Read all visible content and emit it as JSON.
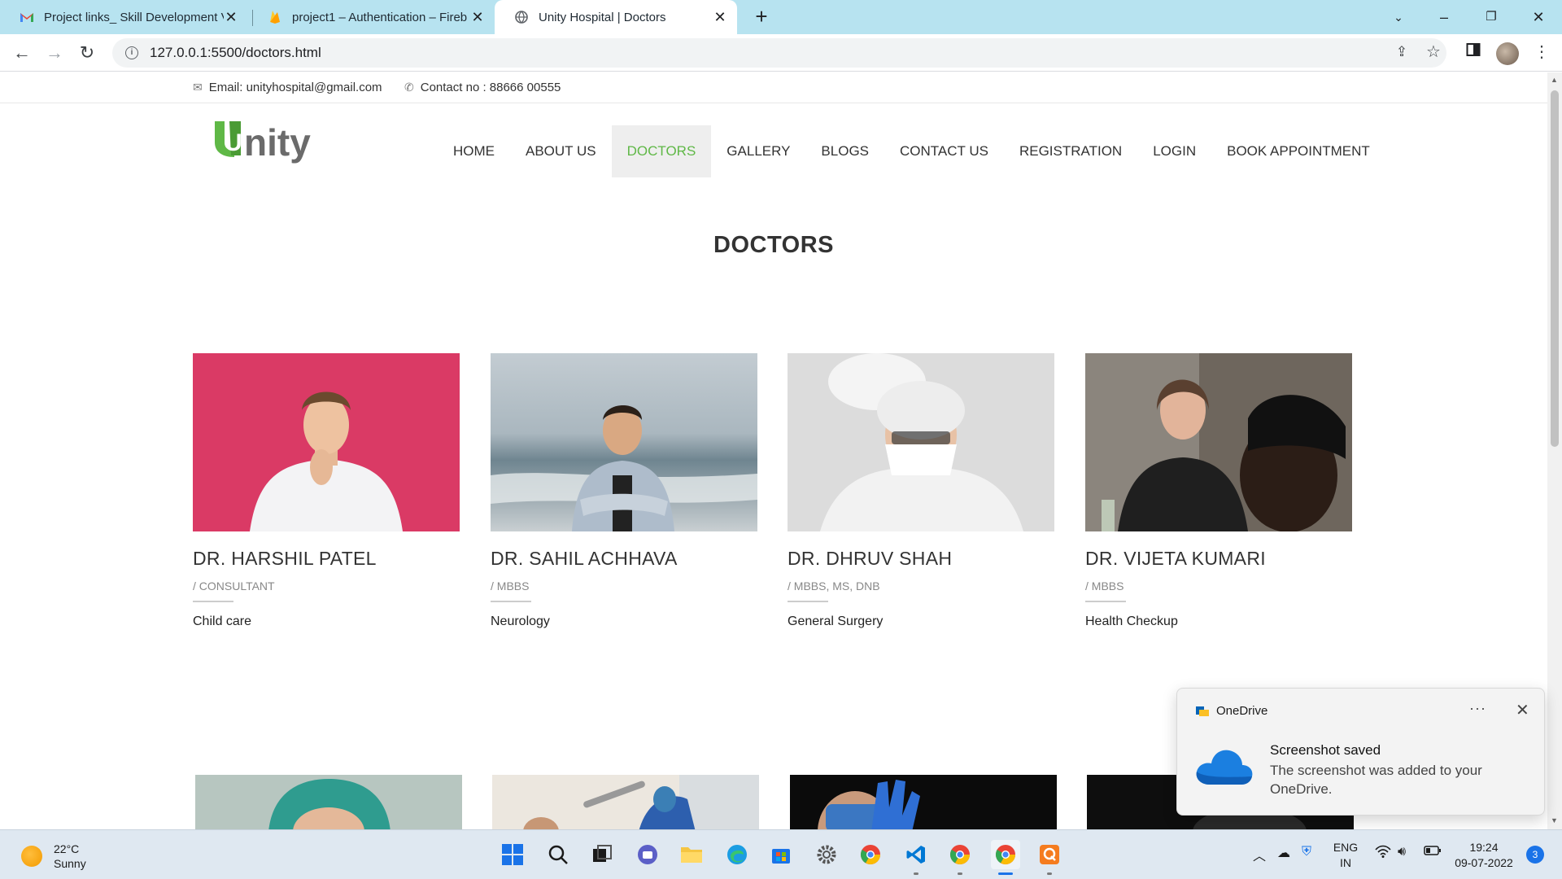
{
  "browser": {
    "tabs": [
      {
        "title": "Project links_ Skill Development V",
        "favicon": "gmail-icon"
      },
      {
        "title": "project1 – Authentication – Fireb",
        "favicon": "firebase-icon"
      },
      {
        "title": "Unity Hospital | Doctors",
        "favicon": "globe-icon"
      }
    ],
    "url": "127.0.0.1:5500/doctors.html"
  },
  "site": {
    "email": "Email: unityhospital@gmail.com",
    "contact": "Contact no : 88666 00555",
    "logo_text": "nity",
    "logo_letter": "U",
    "nav": [
      "HOME",
      "ABOUT US",
      "DOCTORS",
      "GALLERY",
      "BLOGS",
      "CONTACT US",
      "REGISTRATION",
      "LOGIN",
      "BOOK APPOINTMENT"
    ],
    "active_nav": "DOCTORS",
    "accent": "#5fb846",
    "page_title": "DOCTORS",
    "doctors": [
      {
        "name": "DR. HARSHIL PATEL",
        "qual": "/ CONSULTANT",
        "spec": "Child care"
      },
      {
        "name": "DR. SAHIL ACHHAVA",
        "qual": "/ MBBS",
        "spec": "Neurology"
      },
      {
        "name": "DR. DHRUV SHAH",
        "qual": "/ MBBS, MS, DNB",
        "spec": "General Surgery"
      },
      {
        "name": "DR. VIJETA KUMARI",
        "qual": "/ MBBS",
        "spec": "Health Checkup"
      }
    ]
  },
  "toast": {
    "app": "OneDrive",
    "title": "Screenshot saved",
    "body": "The screenshot was added to your OneDrive.",
    "more": "···"
  },
  "taskbar": {
    "temp": "22°C",
    "weather": "Sunny",
    "lang": "ENG",
    "region": "IN",
    "time": "19:24",
    "date": "09-07-2022",
    "notifications": "3"
  }
}
